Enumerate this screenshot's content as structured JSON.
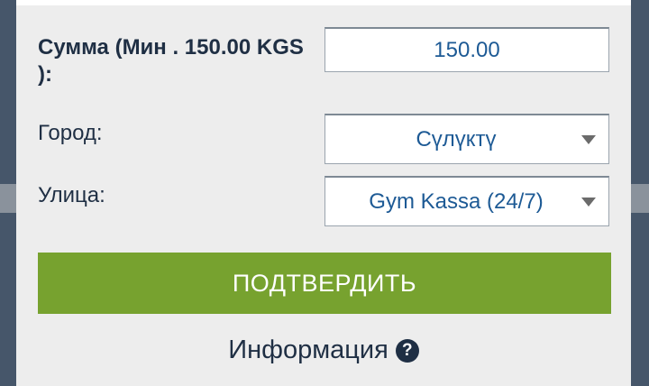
{
  "form": {
    "amount": {
      "label": "Сумма (Мин . 150.00 KGS ):",
      "value": "150.00"
    },
    "city": {
      "label": "Город:",
      "selected": "Сүлүктү"
    },
    "street": {
      "label": "Улица:",
      "selected": "Gym Kassa (24/7)"
    },
    "confirm_label": "ПОДТВЕРДИТЬ"
  },
  "info": {
    "label": "Информация",
    "icon_glyph": "?",
    "icon": "question-circle-icon"
  },
  "colors": {
    "accent_button": "#77a22f",
    "field_text": "#1d5a95",
    "label_text": "#1f2f44",
    "panel_background": "#ededed",
    "page_background": "#46566a"
  }
}
